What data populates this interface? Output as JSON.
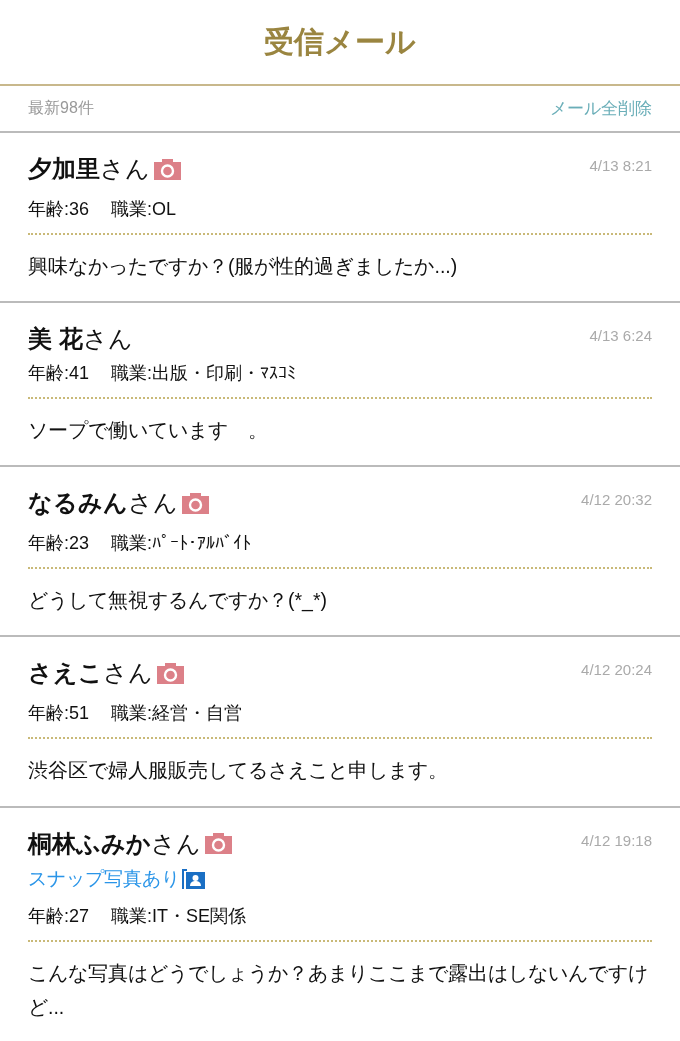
{
  "header": {
    "title": "受信メール"
  },
  "toolbar": {
    "count": "最新98件",
    "delete_all": "メール全削除"
  },
  "mails": [
    {
      "name": "**夕加里**さん",
      "has_photo": true,
      "time": "4/13 8:21",
      "age": "年齢:36",
      "job": "職業:OL",
      "message": "興味なかったですか？(服が性的過ぎましたか...)"
    },
    {
      "name": "**美 花**さん",
      "has_photo": false,
      "time": "4/13 6:24",
      "age": "年齢:41",
      "job": "職業:出版・印刷・ﾏｽｺﾐ",
      "message": "ソープで働いています　。"
    },
    {
      "name": "**なるみん**さん",
      "has_photo": true,
      "time": "4/12 20:32",
      "age": "年齢:23",
      "job": "職業:ﾊﾟｰﾄ･ｱﾙﾊﾞｲﾄ",
      "message": "どうして無視するんですか？(*_*)"
    },
    {
      "name": "**さえこ**さん",
      "has_photo": true,
      "time": "4/12 20:24",
      "age": "年齢:51",
      "job": "職業:経営・自営",
      "message": "渋谷区で婦人服販売してるさえこと申します。"
    },
    {
      "name": "**桐林ふみか**さん",
      "has_photo": true,
      "time": "4/12 19:18",
      "snap": "スナップ写真あり",
      "age": "年齢:27",
      "job": "職業:IT・SE関係",
      "message": "こんな写真はどうでしょうか？あまりここまで露出はしないんですけど..."
    }
  ]
}
